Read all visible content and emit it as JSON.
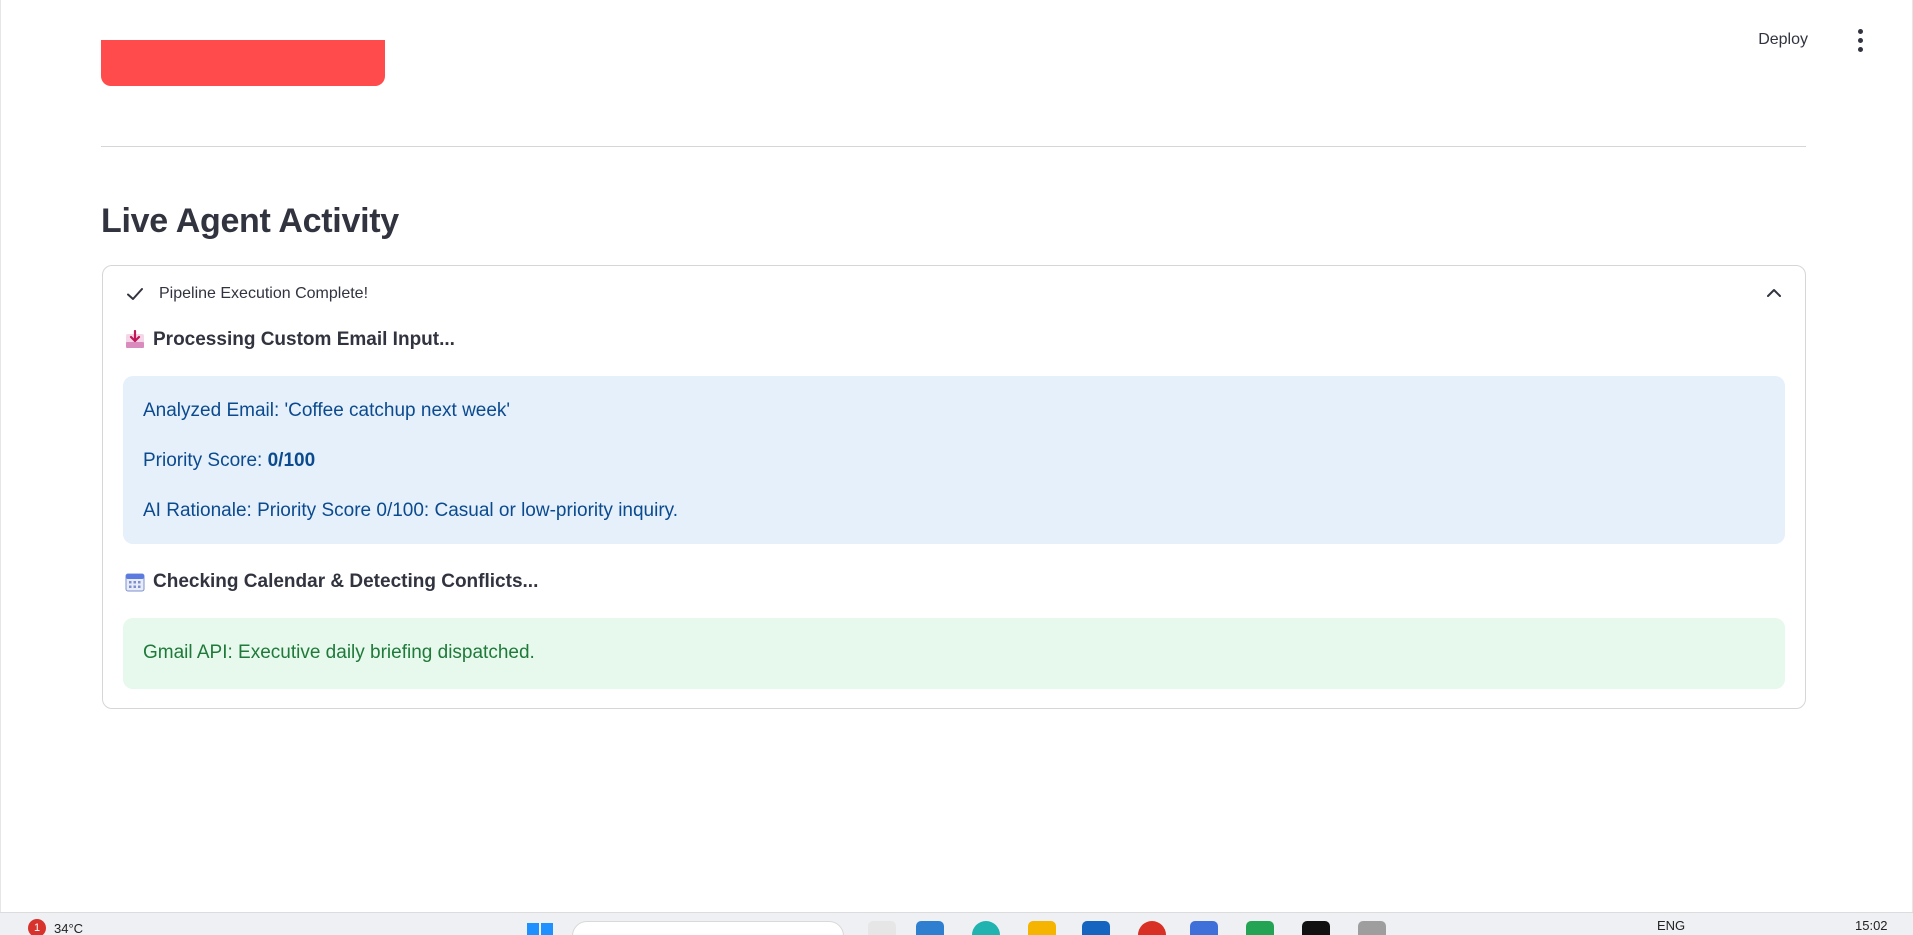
{
  "header": {
    "deploy_label": "Deploy",
    "menu_icon": "kebab-menu-icon"
  },
  "main": {
    "section_title": "Live Agent Activity",
    "expander": {
      "label": "Pipeline Execution Complete!",
      "status_icon": "check-icon",
      "toggle_icon": "chevron-up-icon",
      "steps": [
        {
          "icon": "inbox-tray-icon",
          "text": "Processing Custom Email Input..."
        },
        {
          "icon": "calendar-icon",
          "text": "Checking Calendar & Detecting Conflicts..."
        }
      ],
      "info": {
        "analyzed_email": "Analyzed Email: 'Coffee catchup next week'",
        "priority_prefix": "Priority Score: ",
        "priority_value": "0/100",
        "rationale": "AI Rationale: Priority Score 0/100: Casual or low-priority inquiry."
      },
      "success": {
        "message": "Gmail API: Executive daily briefing dispatched."
      }
    }
  },
  "taskbar": {
    "weather_badge": "1",
    "temperature": "34°C",
    "language": "ENG",
    "time": "15:02",
    "notification_badge": "1"
  },
  "colors": {
    "primary_button": "#ff4b4b",
    "info_bg": "#e5f0fb",
    "info_text": "#0b4a8f",
    "success_bg": "#e7f8ed",
    "success_text": "#1f7a3a"
  }
}
